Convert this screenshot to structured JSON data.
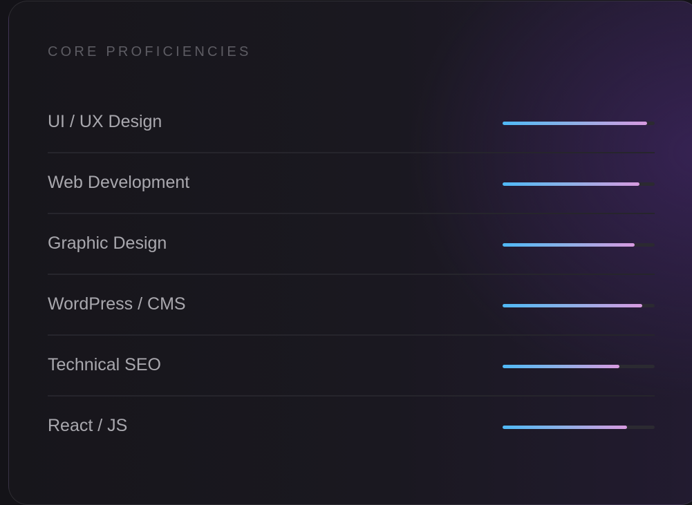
{
  "card": {
    "title": "CORE PROFICIENCIES"
  },
  "skills": [
    {
      "label": "UI / UX Design",
      "level": 0.95
    },
    {
      "label": "Web Development",
      "level": 0.9
    },
    {
      "label": "Graphic Design",
      "level": 0.87
    },
    {
      "label": "WordPress / CMS",
      "level": 0.92
    },
    {
      "label": "Technical SEO",
      "level": 0.77
    },
    {
      "label": "React / JS",
      "level": 0.82
    }
  ],
  "colors": {
    "bar_start": "#4fb9f6",
    "bar_end": "#d89ae0",
    "track": "#2b2a31",
    "label": "#a9a8ae",
    "title": "#5d5c63"
  }
}
